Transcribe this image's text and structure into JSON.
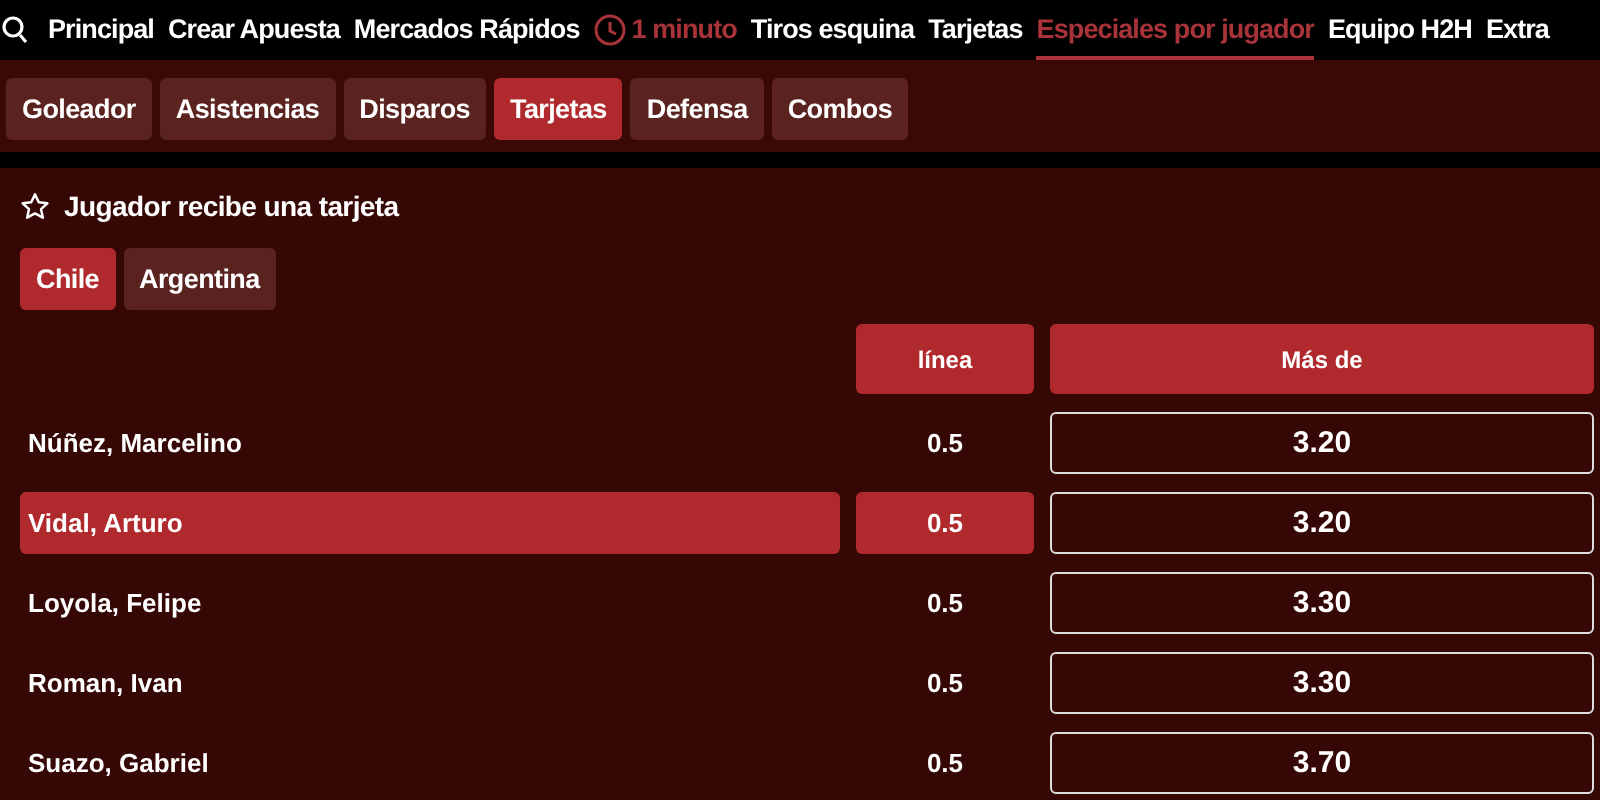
{
  "nav": [
    {
      "kind": "link",
      "label": "Principal",
      "selected": false
    },
    {
      "kind": "link",
      "label": "Crear Apuesta",
      "selected": false
    },
    {
      "kind": "link",
      "label": "Mercados Rápidos",
      "selected": false
    },
    {
      "kind": "timer",
      "label": "1 minuto",
      "selected": false
    },
    {
      "kind": "link",
      "label": "Tiros esquina",
      "selected": false
    },
    {
      "kind": "link",
      "label": "Tarjetas",
      "selected": false
    },
    {
      "kind": "link",
      "label": "Especiales por jugador",
      "selected": true
    },
    {
      "kind": "link",
      "label": "Equipo H2H",
      "selected": false
    },
    {
      "kind": "link",
      "label": "Extra",
      "selected": false
    }
  ],
  "subtabs": [
    {
      "label": "Goleador",
      "selected": false
    },
    {
      "label": "Asistencias",
      "selected": false
    },
    {
      "label": "Disparos",
      "selected": false
    },
    {
      "label": "Tarjetas",
      "selected": true
    },
    {
      "label": "Defensa",
      "selected": false
    },
    {
      "label": "Combos",
      "selected": false
    }
  ],
  "market": {
    "title": "Jugador recibe una tarjeta",
    "teams": [
      {
        "label": "Chile",
        "selected": true
      },
      {
        "label": "Argentina",
        "selected": false
      }
    ],
    "columns": [
      "línea",
      "Más de"
    ],
    "rows": [
      {
        "player": "Núñez, Marcelino",
        "line": "0.5",
        "odds": "3.20",
        "selected": false
      },
      {
        "player": "Vidal, Arturo",
        "line": "0.5",
        "odds": "3.20",
        "selected": true
      },
      {
        "player": "Loyola, Felipe",
        "line": "0.5",
        "odds": "3.30",
        "selected": false
      },
      {
        "player": "Roman, Ivan",
        "line": "0.5",
        "odds": "3.30",
        "selected": false
      },
      {
        "player": "Suazo, Gabriel",
        "line": "0.5",
        "odds": "3.70",
        "selected": false
      }
    ]
  }
}
